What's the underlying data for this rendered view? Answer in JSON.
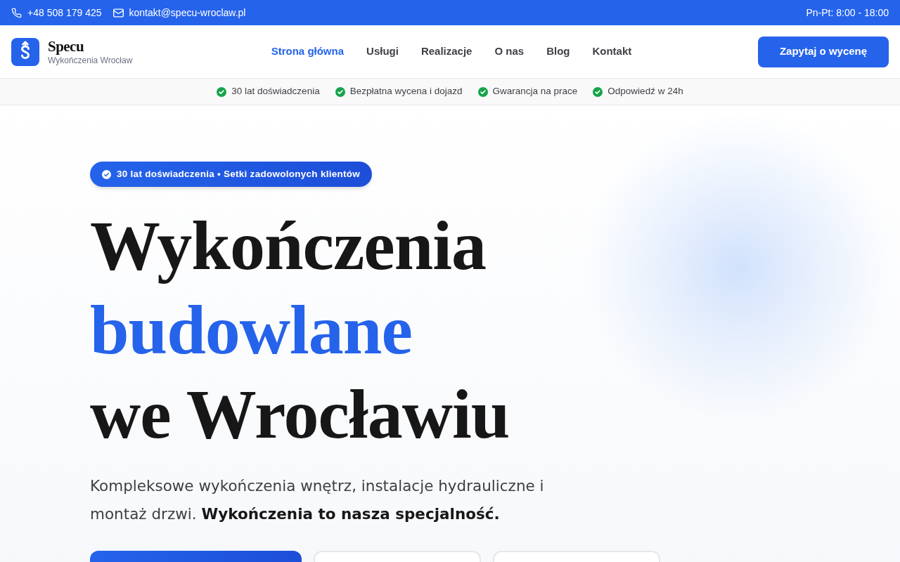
{
  "top_bar": {
    "phone": "+48 508 179 425",
    "email": "kontakt@specu-wroclaw.pl",
    "hours": "Pn-Pt: 8:00 - 18:00"
  },
  "header": {
    "logo": {
      "name": "Specu",
      "tagline": "Wykończenia Wrocław"
    },
    "nav": [
      {
        "label": "Strona główna",
        "selected": true
      },
      {
        "label": "Usługi",
        "selected": false
      },
      {
        "label": "Realizacje",
        "selected": false
      },
      {
        "label": "O nas",
        "selected": false
      },
      {
        "label": "Blog",
        "selected": false
      },
      {
        "label": "Kontakt",
        "selected": false
      }
    ],
    "cta": "Zapytaj o wycenę"
  },
  "trust_bar": [
    "30 lat doświadczenia",
    "Bezpłatna wycena i dojazd",
    "Gwarancja na prace",
    "Odpowiedź w 24h"
  ],
  "hero": {
    "badge": "30 lat doświadczenia • Setki zadowolonych klientów",
    "headline": [
      {
        "text": "Wykończenia",
        "accent": false
      },
      {
        "text": "budowlane",
        "accent": true
      },
      {
        "text": "we Wrocławiu",
        "accent": false
      }
    ],
    "lead": "Kompleksowe wykończenia wnętrz, instalacje hydrauliczne i montaż drzwi. **Wykończenia to nasza specjalność.**",
    "buttons": [
      {
        "kind": "primary"
      },
      {
        "kind": "outline"
      },
      {
        "kind": "outline"
      }
    ]
  }
}
